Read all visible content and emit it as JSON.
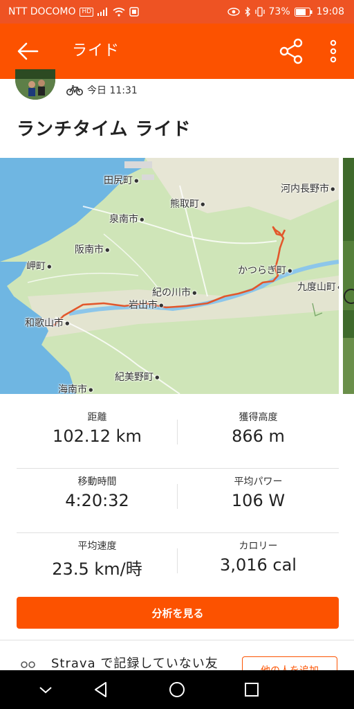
{
  "status_bar": {
    "carrier": "NTT DOCOMO",
    "hd": "HD",
    "battery": "73%",
    "time": "19:08"
  },
  "app_bar": {
    "title": "ライド",
    "back_icon": "arrow-left-icon",
    "share_icon": "share-icon",
    "more_icon": "more-vertical-icon"
  },
  "activity": {
    "timestamp": "今日 11:31",
    "type_icon": "bike-icon",
    "title": "ランチタイム ライド"
  },
  "map": {
    "water_color": "#6fb6e2",
    "land_color": "#cfe5b8",
    "route_color": "#e2572b",
    "labels": [
      "田尻町",
      "泉南市",
      "熊取町",
      "阪南市",
      "岬町",
      "河内長野市",
      "かつらぎ町",
      "紀の川市",
      "岩出市",
      "九度山町",
      "和歌山市",
      "紀美野町",
      "海南市"
    ]
  },
  "stats": [
    {
      "left": {
        "label": "距離",
        "value": "102.12 km"
      },
      "right": {
        "label": "獲得高度",
        "value": "866 m"
      }
    },
    {
      "left": {
        "label": "移動時間",
        "value": "4:20:32"
      },
      "right": {
        "label": "平均パワー",
        "value": "106 W"
      }
    },
    {
      "left": {
        "label": "平均速度",
        "value": "23.5 km/時"
      },
      "right": {
        "label": "カロリー",
        "value": "3,016 cal"
      }
    }
  ],
  "analyze_button": "分析を見る",
  "friend_promo": {
    "text": "Strava で記録していない友",
    "button": "他の人を追加"
  },
  "nav": {
    "back": "nav-back-icon",
    "home": "nav-home-icon",
    "recents": "nav-recents-icon",
    "down": "nav-down-icon"
  },
  "colors": {
    "accent": "#fc5200",
    "status_bar": "#ee5323"
  }
}
